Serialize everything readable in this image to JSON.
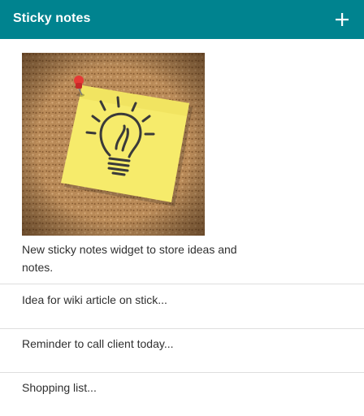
{
  "header": {
    "title": "Sticky notes",
    "add_icon": "plus-icon",
    "background": "#00838f"
  },
  "notes": [
    {
      "text": "New sticky notes widget to store ideas and notes.",
      "image": "sticky-note-lightbulb-on-corkboard"
    },
    {
      "text": "Idea for wiki article on stick..."
    },
    {
      "text": "Reminder to call client today..."
    },
    {
      "text": "Shopping list..."
    }
  ]
}
